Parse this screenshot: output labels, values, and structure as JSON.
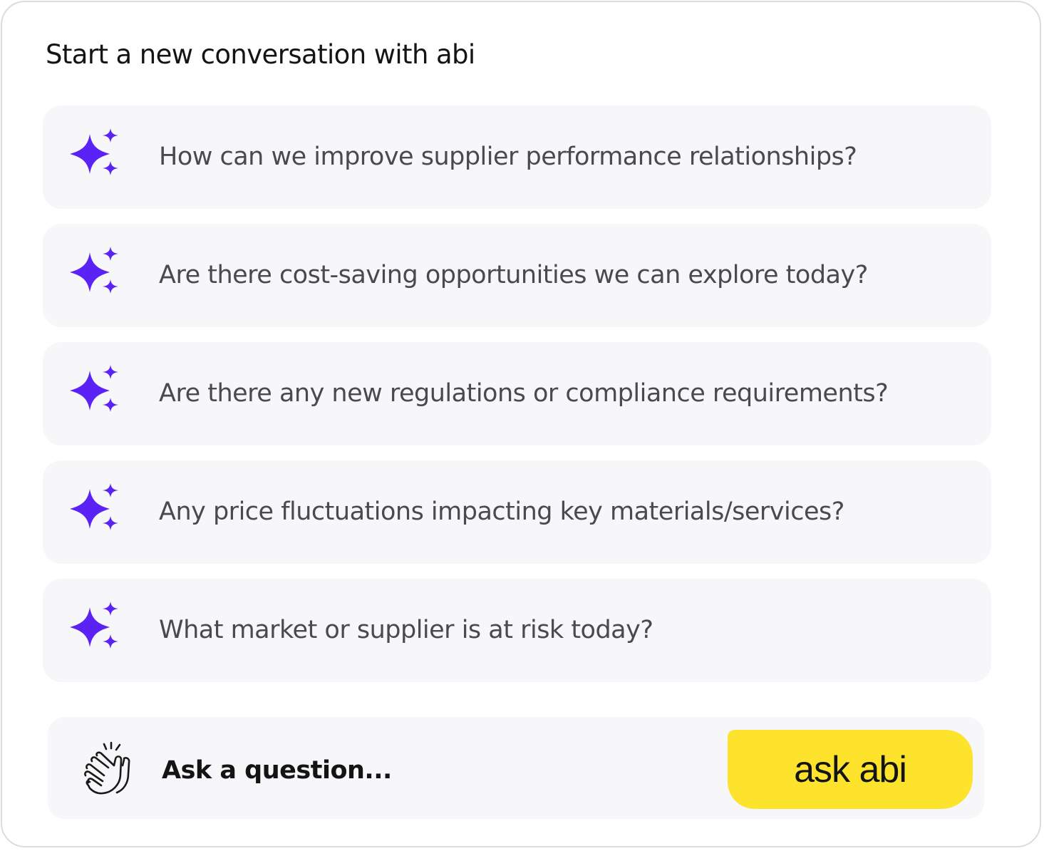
{
  "title": "Start a new conversation with abi",
  "suggestions": [
    {
      "label": "How can we improve supplier performance relationships?",
      "icon": "sparkles-icon"
    },
    {
      "label": "Are there cost-saving opportunities we can explore today?",
      "icon": "sparkles-icon"
    },
    {
      "label": "Are there any new regulations or compliance requirements?",
      "icon": "sparkles-icon"
    },
    {
      "label": "Any price fluctuations impacting key materials/services?",
      "icon": "sparkles-icon"
    },
    {
      "label": "What market or supplier is at risk today?",
      "icon": "sparkles-icon"
    }
  ],
  "input": {
    "icon": "clapping-hands-icon",
    "value": "",
    "placeholder": "Ask a question..."
  },
  "ask_button": {
    "label": "ask abi"
  },
  "colors": {
    "accent": "#5a22f5",
    "button_bg": "#fde32b",
    "card_bg": "#f7f7f9",
    "suggestion_text": "#4a4a4e",
    "title_text": "#141414"
  }
}
